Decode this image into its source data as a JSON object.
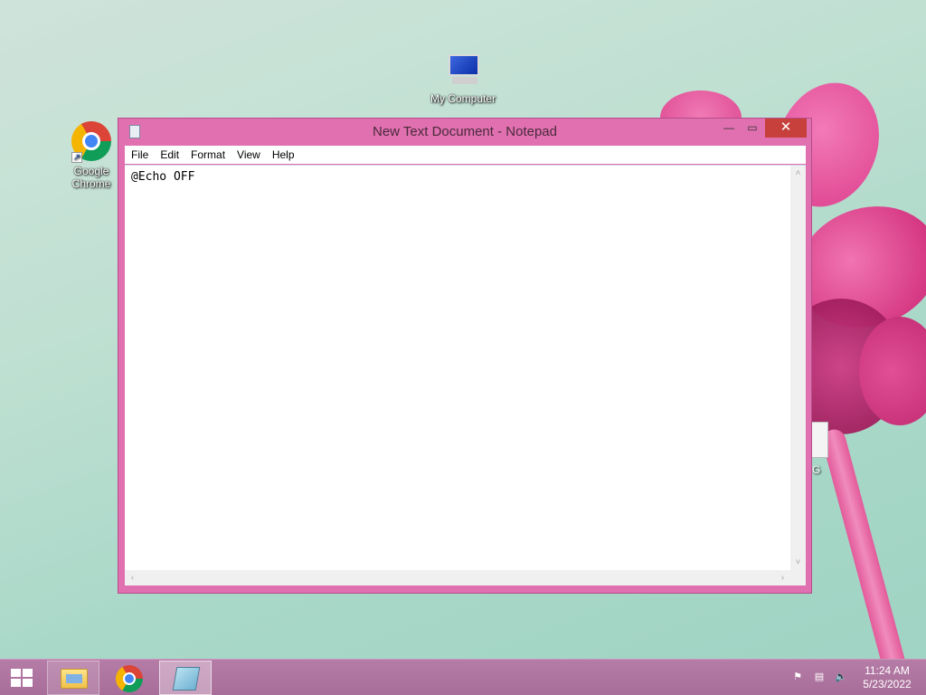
{
  "desktop": {
    "icons": [
      {
        "label": "My Computer",
        "icon": "computer-icon"
      },
      {
        "label": "Google Chrome",
        "icon": "chrome-icon"
      },
      {
        "label": "G",
        "icon": "document-icon"
      }
    ]
  },
  "notepad": {
    "title": "New Text Document - Notepad",
    "menu": [
      "File",
      "Edit",
      "Format",
      "View",
      "Help"
    ],
    "content": "@Echo OFF",
    "buttons": {
      "minimize": "—",
      "maximize": "▭",
      "close": "✕"
    }
  },
  "taskbar": {
    "items": [
      "file-explorer",
      "google-chrome",
      "notepad"
    ],
    "tray": {
      "flag_icon": "⚑",
      "network_icon": "▤",
      "volume_icon": "🔈"
    },
    "clock": {
      "time": "11:24 AM",
      "date": "5/23/2022"
    }
  }
}
